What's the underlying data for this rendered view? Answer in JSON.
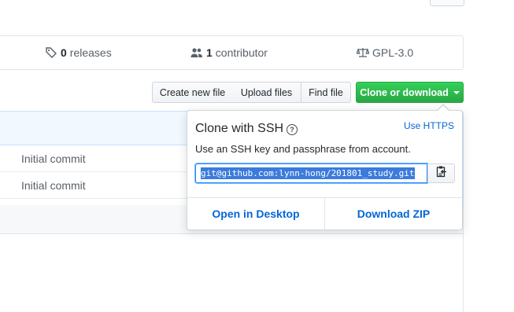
{
  "summary": {
    "releases": {
      "count": "0",
      "label": "releases",
      "icon": "tag-icon"
    },
    "contributors": {
      "count": "1",
      "label": "contributor",
      "icon": "people-icon"
    },
    "license": {
      "label": "GPL-3.0",
      "icon": "law-icon"
    }
  },
  "file_nav": {
    "create_label": "Create new file",
    "upload_label": "Upload files",
    "find_label": "Find file",
    "clone_label": "Clone or download"
  },
  "files": [
    {
      "message": "Initial commit"
    },
    {
      "message": "Initial commit"
    }
  ],
  "clone": {
    "title": "Clone with SSH",
    "switch_label": "Use HTTPS",
    "description": "Use an SSH key and passphrase from account.",
    "url": "git@github.com:lynn-hong/201801_study.git",
    "open_desktop_label": "Open in Desktop",
    "download_zip_label": "Download ZIP"
  },
  "colors": {
    "accent": "#0366d6",
    "primary_button": "#28a745",
    "selection": "#3b7bdc"
  }
}
